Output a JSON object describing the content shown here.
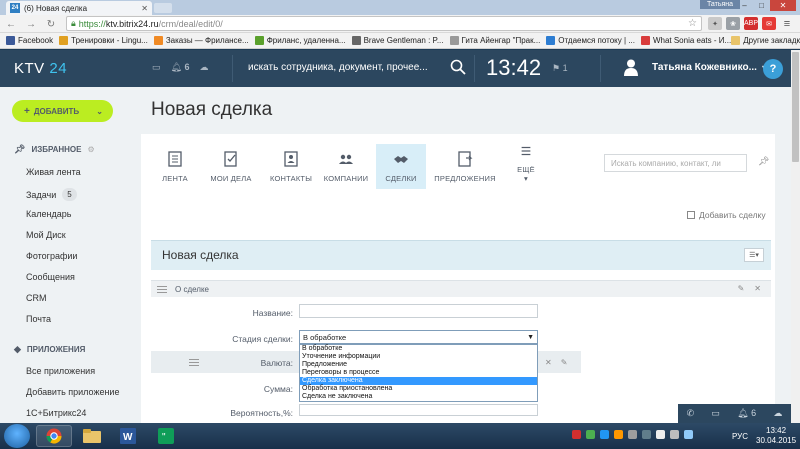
{
  "browser": {
    "tab_title": "(6) Новая сделка",
    "tab_favicon": "24",
    "user_badge": "Татьяна",
    "url_scheme": "https://",
    "url_host": "ktv.bitrix24.ru",
    "url_path": "/crm/deal/edit/0/",
    "bookmarks": [
      {
        "label": "Facebook",
        "icon": "facebook-icon",
        "color": "#3b5998"
      },
      {
        "label": "Тренировки - Lingu...",
        "icon": "lingualeo-icon",
        "color": "#e0a021"
      },
      {
        "label": "Заказы — Фрилансе...",
        "icon": "freelance-icon",
        "color": "#f08a24"
      },
      {
        "label": "Фриланс, удаленна...",
        "icon": "fl-icon",
        "color": "#5aa02c"
      },
      {
        "label": "Brave Gentleman : P...",
        "icon": "medium-icon",
        "color": "#666666"
      },
      {
        "label": "Гита Айенгар \"Прак...",
        "icon": "page-icon",
        "color": "#999999"
      },
      {
        "label": "Отдаемся потоку | ...",
        "icon": "yt-icon",
        "color": "#2d7dd2"
      },
      {
        "label": "What Sonia eats - И...",
        "icon": "heart-icon",
        "color": "#d93c3c"
      }
    ],
    "other_bookmarks": "Другие закладки"
  },
  "header": {
    "logo_text": "KTV",
    "logo_num": "24",
    "notifications_count": "6",
    "search_placeholder": "искать сотрудника, документ, прочее...",
    "clock": "13:42",
    "flag_count": "1",
    "user_name": "Татьяна Кожевнико...",
    "help": "?"
  },
  "sidebar": {
    "add_button": "ДОБАВИТЬ",
    "favorites_title": "ИЗБРАННОЕ",
    "favorites": [
      {
        "label": "Живая лента"
      },
      {
        "label": "Задачи",
        "badge": "5"
      },
      {
        "label": "Календарь"
      },
      {
        "label": "Мой Диск"
      },
      {
        "label": "Фотографии"
      },
      {
        "label": "Сообщения"
      },
      {
        "label": "CRM"
      },
      {
        "label": "Почта"
      }
    ],
    "apps_title": "ПРИЛОЖЕНИЯ",
    "apps": [
      {
        "label": "Все приложения"
      },
      {
        "label": "Добавить приложение"
      },
      {
        "label": "1С+Битрикс24"
      }
    ]
  },
  "main": {
    "page_title": "Новая сделка",
    "tabs": [
      {
        "label": "ЛЕНТА",
        "icon": "feed-icon"
      },
      {
        "label": "МОИ ДЕЛА",
        "icon": "tasks-icon"
      },
      {
        "label": "КОНТАКТЫ",
        "icon": "contacts-icon"
      },
      {
        "label": "КОМПАНИИ",
        "icon": "companies-icon"
      },
      {
        "label": "СДЕЛКИ",
        "icon": "deals-icon",
        "active": true
      },
      {
        "label": "ПРЕДЛОЖЕНИЯ",
        "icon": "offers-icon"
      },
      {
        "label": "ЕЩЁ",
        "icon": "more-icon"
      }
    ],
    "search_placeholder": "Искать компанию, контакт, ли",
    "copy_deal": "Добавить сделку",
    "deal_title": "Новая сделка",
    "section_title": "О сделке",
    "fields": {
      "name_label": "Название:",
      "stage_label": "Стадия сделки:",
      "currency_label": "Валюта:",
      "sum_label": "Сумма:",
      "probability_label": "Вероятность,%:"
    },
    "stage_selected": "В обработке",
    "stage_options": [
      "В обработке",
      "Уточнение информации",
      "Предложение",
      "Переговоры в процессе",
      "Сделка заключена",
      "Обработка приостановлена",
      "Сделка не заключена"
    ],
    "stage_highlighted_index": 4
  },
  "bottom_widget": {
    "count": "6"
  },
  "taskbar": {
    "lang": "РУС",
    "time": "13:42",
    "date": "30.04.2015"
  },
  "colors": {
    "header_bg": "#2c475f",
    "accent_green": "#bbed21",
    "active_tab": "#d8eef8",
    "dropdown_highlight": "#3399ff"
  }
}
